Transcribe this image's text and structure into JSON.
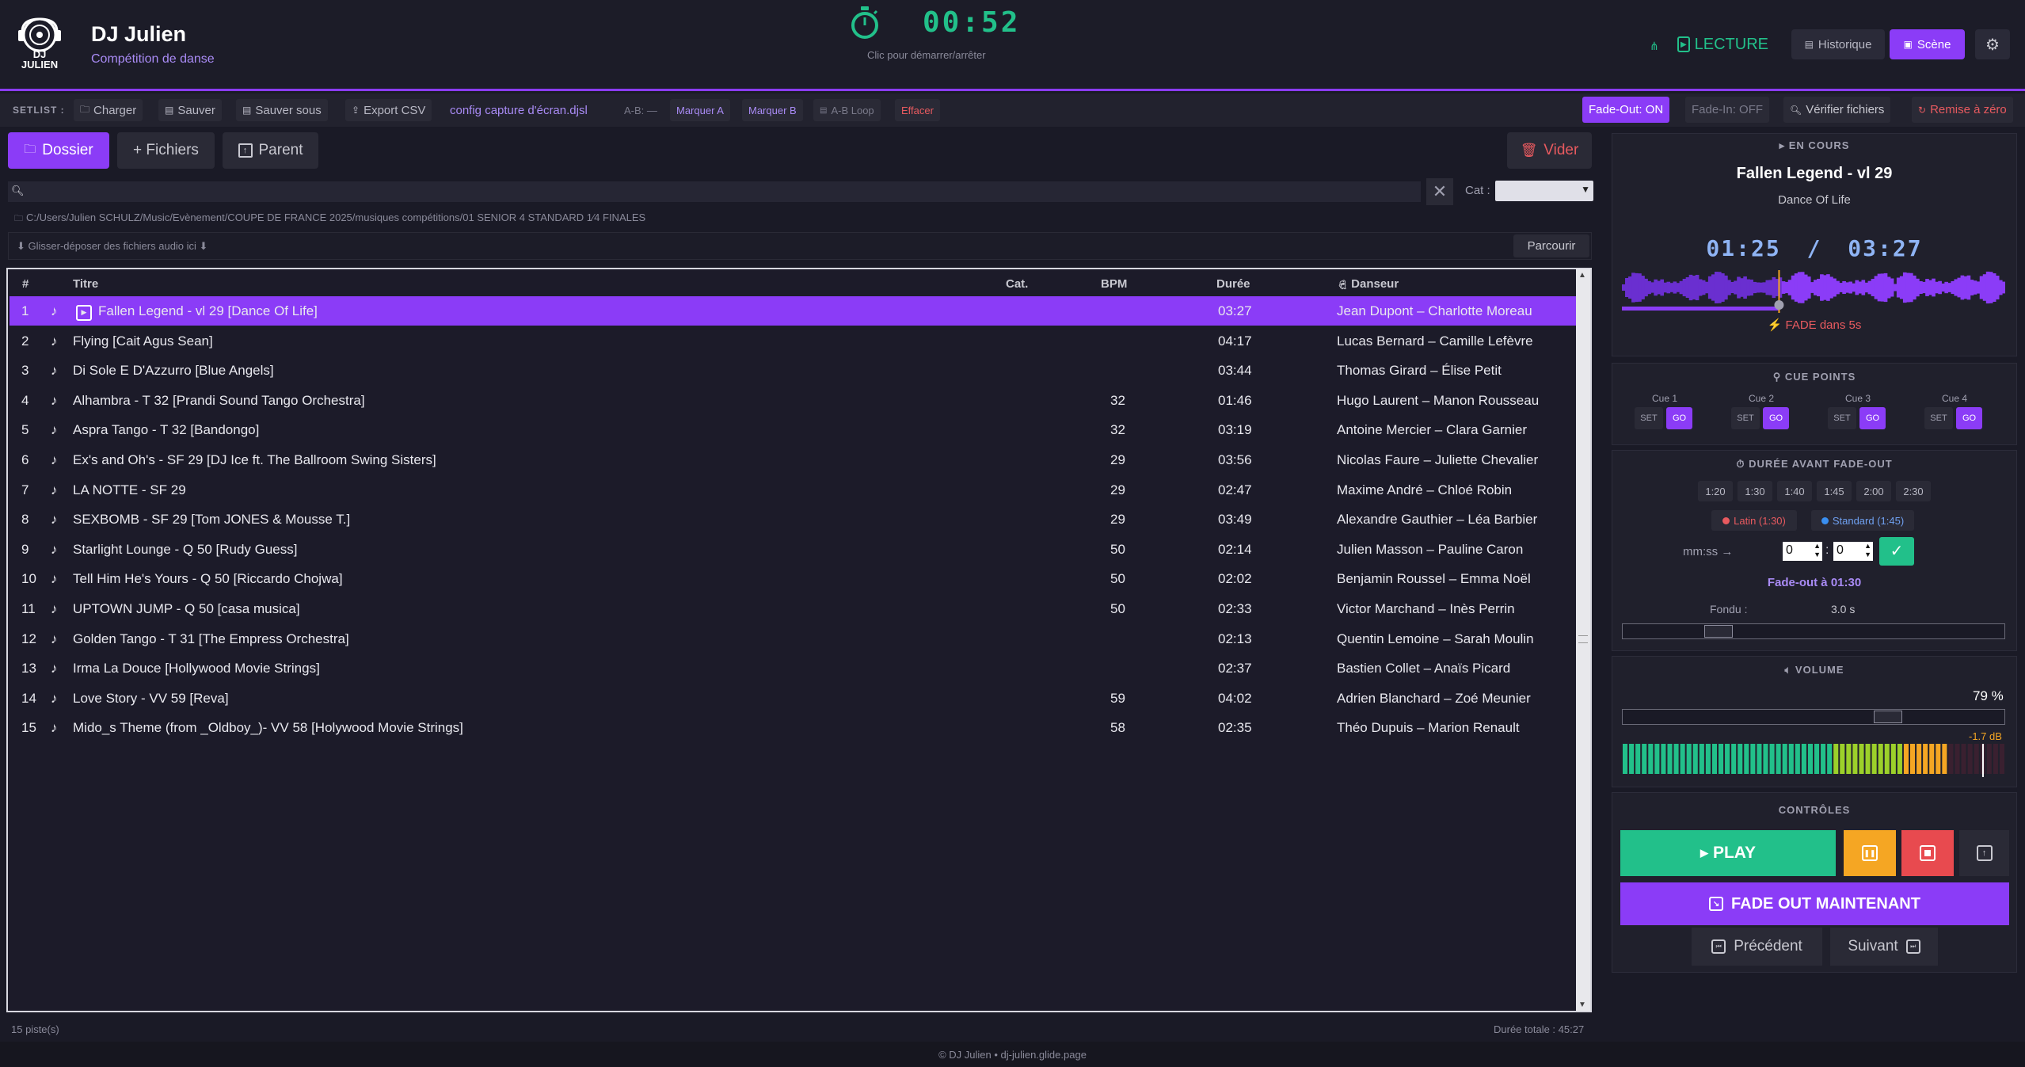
{
  "header": {
    "title": "DJ Julien",
    "subtitle": "Compétition de danse",
    "logo_text_line1": "DJ",
    "logo_text_line2": "JULIEN",
    "timer": "00:52",
    "timer_hint": "Clic pour démarrer/arrêter",
    "mode_label": "LECTURE",
    "history_label": "Historique",
    "scene_label": "Scène"
  },
  "toolbar": {
    "setlist_label": "SETLIST :",
    "load": "Charger",
    "save": "Sauver",
    "save_as": "Sauver sous",
    "export": "Export CSV",
    "config_file": "config capture d'écran.djsl",
    "ab_status": "A-B: —",
    "mark_a": "Marquer A",
    "mark_b": "Marquer B",
    "ab_loop": "A-B Loop",
    "clear": "Effacer",
    "fade_out": "Fade-Out: ON",
    "fade_in": "Fade-In: OFF",
    "check_files": "Vérifier fichiers",
    "reset": "Remise à zéro"
  },
  "library": {
    "folder_btn": "Dossier",
    "files_btn": "+ Fichiers",
    "parent_btn": "Parent",
    "empty_btn": "Vider",
    "search_placeholder": "",
    "cat_label": "Cat :",
    "path": "C:/Users/Julien SCHULZ/Music/Evènement/COUPE DE FRANCE 2025/musiques compétitions/01  SENIOR 4 STANDARD 1⁄4 FINALES",
    "drop_hint": "⬇ Glisser-déposer des fichiers audio ici ⬇",
    "browse_btn": "Parcourir",
    "columns": {
      "num": "#",
      "title": "Titre",
      "cat": "Cat.",
      "bpm": "BPM",
      "duration": "Durée",
      "dancer": "Danseur"
    },
    "tracks": [
      {
        "num": "1",
        "title": "Fallen Legend - vl 29  [Dance Of Life]",
        "bpm": "",
        "dur": "03:27",
        "dancer": "Jean Dupont – Charlotte Moreau"
      },
      {
        "num": "2",
        "title": "Flying  [Cait Agus Sean]",
        "bpm": "",
        "dur": "04:17",
        "dancer": "Lucas Bernard – Camille Lefèvre"
      },
      {
        "num": "3",
        "title": "Di Sole E D'Azzurro  [Blue Angels]",
        "bpm": "",
        "dur": "03:44",
        "dancer": "Thomas Girard – Élise Petit"
      },
      {
        "num": "4",
        "title": "Alhambra - T 32  [Prandi Sound Tango Orchestra]",
        "bpm": "32",
        "dur": "01:46",
        "dancer": "Hugo Laurent – Manon Rousseau"
      },
      {
        "num": "5",
        "title": "Aspra Tango - T 32  [Bandongo]",
        "bpm": "32",
        "dur": "03:19",
        "dancer": "Antoine Mercier – Clara Garnier"
      },
      {
        "num": "6",
        "title": "Ex's and Oh's - SF 29  [DJ Ice ft. The Ballroom Swing Sisters]",
        "bpm": "29",
        "dur": "03:56",
        "dancer": "Nicolas Faure – Juliette Chevalier"
      },
      {
        "num": "7",
        "title": "LA NOTTE - SF 29",
        "bpm": "29",
        "dur": "02:47",
        "dancer": "Maxime André – Chloé Robin"
      },
      {
        "num": "8",
        "title": "SEXBOMB - SF 29  [Tom JONES &  Mousse  T.]",
        "bpm": "29",
        "dur": "03:49",
        "dancer": "Alexandre Gauthier – Léa Barbier"
      },
      {
        "num": "9",
        "title": "Starlight Lounge - Q 50  [Rudy Guess]",
        "bpm": "50",
        "dur": "02:14",
        "dancer": "Julien Masson – Pauline Caron"
      },
      {
        "num": "10",
        "title": "Tell Him He's Yours - Q 50  [Riccardo Chojwa]",
        "bpm": "50",
        "dur": "02:02",
        "dancer": "Benjamin Roussel – Emma Noël"
      },
      {
        "num": "11",
        "title": "UPTOWN JUMP - Q 50  [casa musica]",
        "bpm": "50",
        "dur": "02:33",
        "dancer": "Victor Marchand – Inès Perrin"
      },
      {
        "num": "12",
        "title": "Golden Tango   - T 31  [The Empress Orchestra]",
        "bpm": "",
        "dur": "02:13",
        "dancer": "Quentin Lemoine – Sarah Moulin"
      },
      {
        "num": "13",
        "title": "Irma La Douce  [Hollywood Movie Strings]",
        "bpm": "",
        "dur": "02:37",
        "dancer": "Bastien Collet – Anaïs Picard"
      },
      {
        "num": "14",
        "title": "Love Story - VV 59  [Reva]",
        "bpm": "59",
        "dur": "04:02",
        "dancer": "Adrien Blanchard – Zoé Meunier"
      },
      {
        "num": "15",
        "title": "Mido_s Theme (from _Oldboy_)- VV 58  [Holywood Movie Strings]",
        "bpm": "58",
        "dur": "02:35",
        "dancer": "Théo Dupuis – Marion Renault"
      }
    ],
    "track_count": "15 piste(s)",
    "total_duration": "Durée totale : 45:27"
  },
  "now_playing": {
    "label": "EN COURS",
    "title": "Fallen Legend - vl 29",
    "artist": "Dance Of Life",
    "elapsed": "01:25",
    "separator": "/",
    "total": "03:27",
    "progress": 0.41,
    "fade_warning": "FADE dans 5s"
  },
  "cue_points": {
    "label": "CUE POINTS",
    "cues": [
      {
        "name": "Cue 1"
      },
      {
        "name": "Cue 2"
      },
      {
        "name": "Cue 3"
      },
      {
        "name": "Cue 4"
      }
    ],
    "set_label": "SET",
    "go_label": "GO"
  },
  "fade_settings": {
    "label": "DURÉE AVANT FADE-OUT",
    "presets": [
      "1:20",
      "1:30",
      "1:40",
      "1:45",
      "2:00",
      "2:30"
    ],
    "latin": "Latin (1:30)",
    "standard": "Standard (1:45)",
    "mmss_label": "mm:ss →",
    "min_value": "0",
    "sec_value": "0",
    "colon": ":",
    "fade_at": "Fade-out à 01:30",
    "fondu_label": "Fondu :",
    "fondu_value": "3.0 s",
    "fondu_level": 0.23
  },
  "volume": {
    "label": "VOLUME",
    "percent": "79 %",
    "level": 0.79,
    "db": "-1.7 dB"
  },
  "controls": {
    "label": "CONTRÔLES",
    "play": "PLAY",
    "fade_now": "FADE OUT MAINTENANT",
    "prev": "Précédent",
    "next": "Suivant"
  },
  "footer": {
    "credit": "© DJ Julien  •  dj-julien.glide.page"
  },
  "colors": {
    "accent": "#8b3cf7",
    "play": "#22c08a",
    "pause": "#f5a623",
    "stop": "#e84a4f"
  }
}
